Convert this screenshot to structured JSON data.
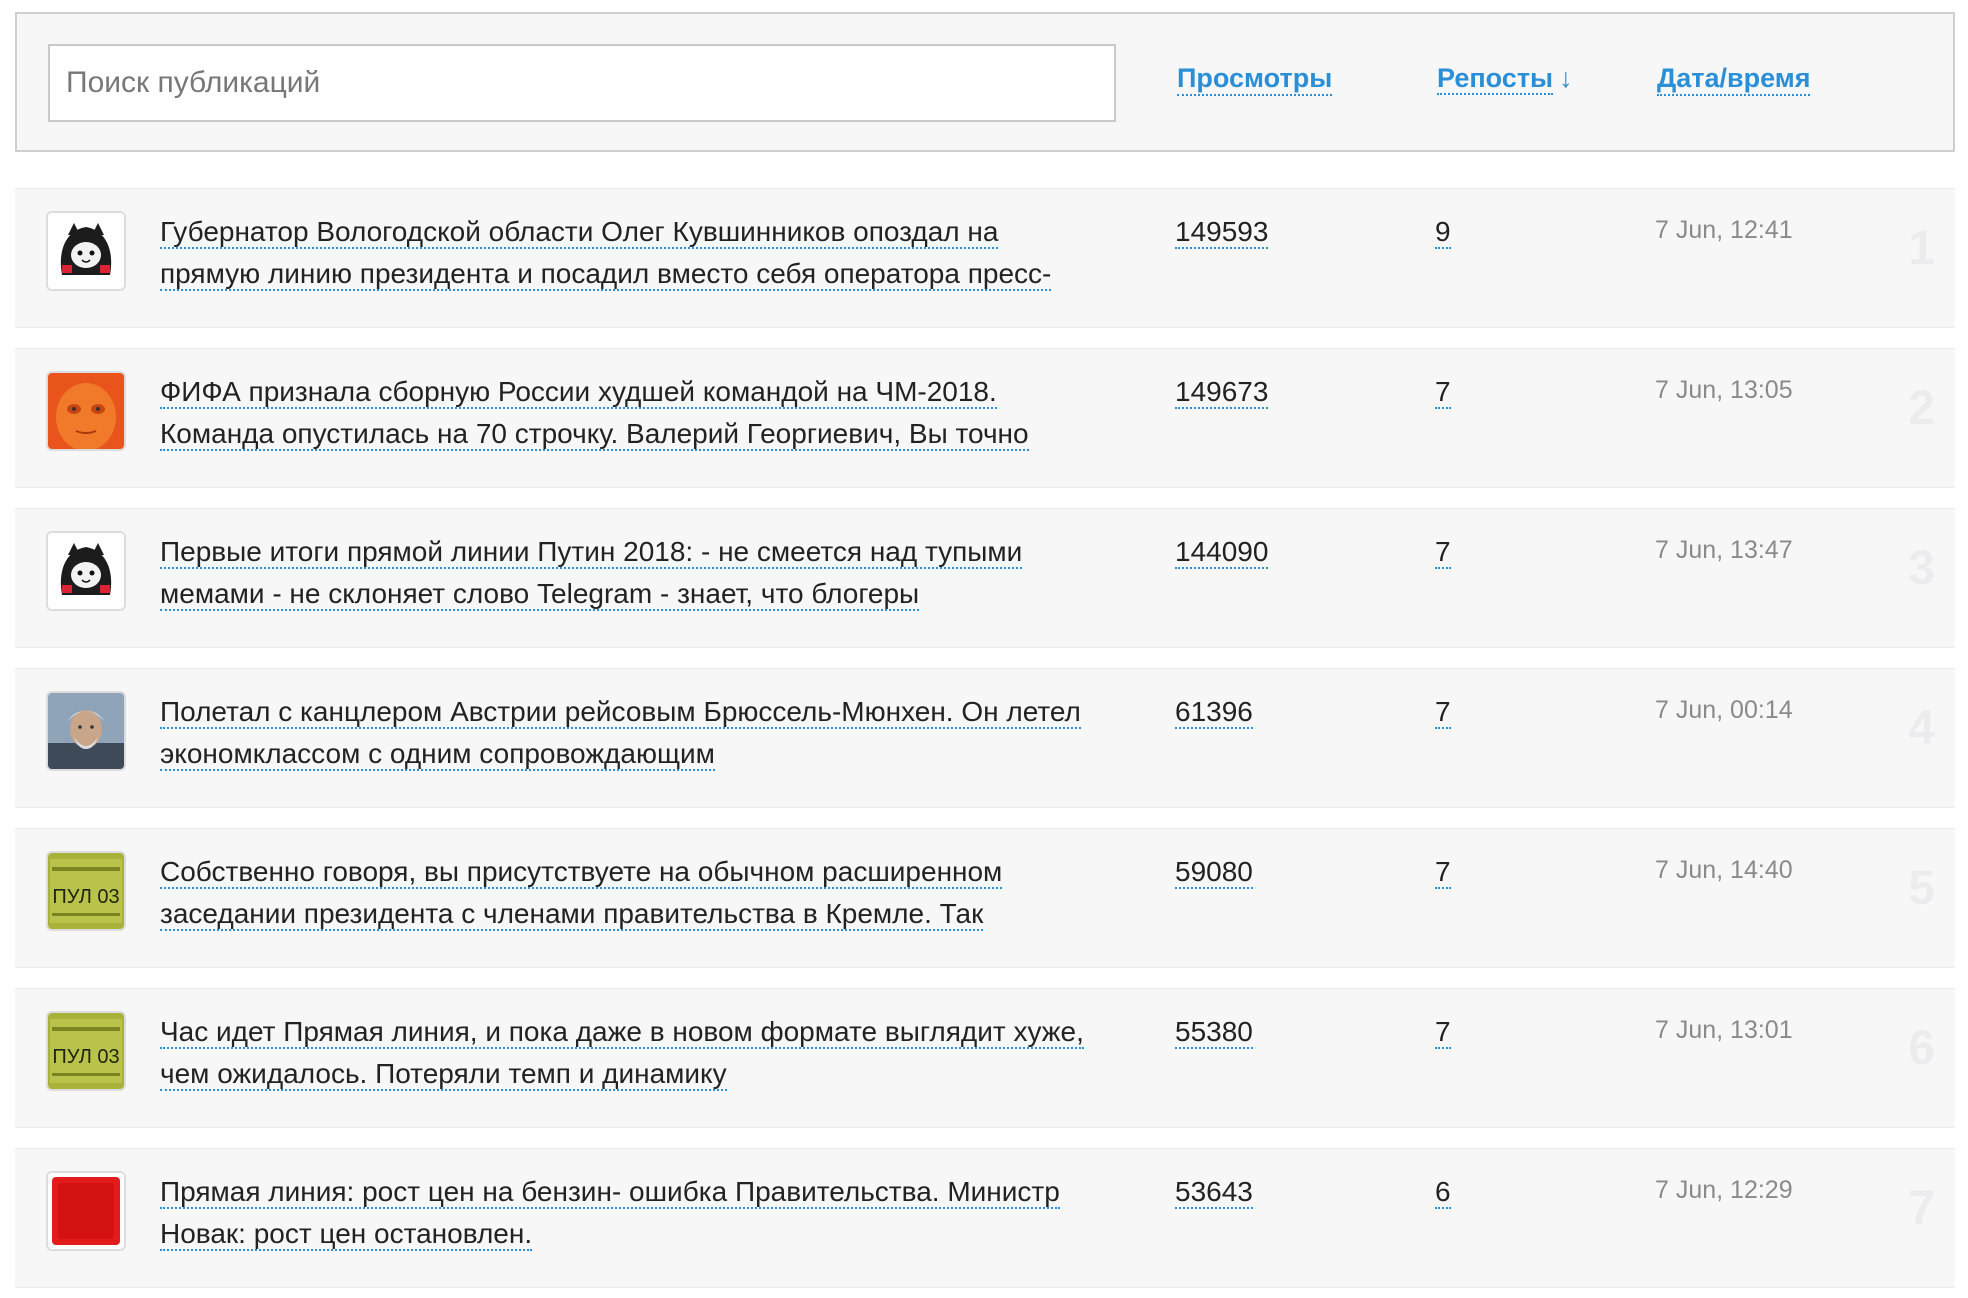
{
  "search": {
    "placeholder": "Поиск публикаций",
    "value": ""
  },
  "columns": {
    "views": "Просмотры",
    "reposts": "Репосты",
    "reposts_arrow": "↓",
    "date": "Дата/время"
  },
  "colors": {
    "accent": "#2a8fd6",
    "row_bg": "#f7f7f8",
    "muted": "#8a8a8a"
  },
  "posts": [
    {
      "rank": "1",
      "avatar": "hooded-cat-avatar",
      "title": "Губернатор Вологодской области Олег Кувшинников опоздал на прямую линию президента и посадил вместо себя оператора пресс-",
      "views": "149593",
      "reposts": "9",
      "date": "7 Jun, 12:41"
    },
    {
      "rank": "2",
      "avatar": "orange-face-avatar",
      "title": "ФИФА признала сборную России худшей командой на ЧМ-2018. Команда опустилась на 70 строчку. Валерий Георгиевич, Вы точно",
      "views": "149673",
      "reposts": "7",
      "date": "7 Jun, 13:05"
    },
    {
      "rank": "3",
      "avatar": "hooded-cat-avatar",
      "title": "Первые итоги прямой линии Путин 2018: - не смеется над тупыми мемами - не склоняет слово Telegram - знает, что блогеры",
      "views": "144090",
      "reposts": "7",
      "date": "7 Jun, 13:47"
    },
    {
      "rank": "4",
      "avatar": "old-man-photo-avatar",
      "title": "Полетал с канцлером Австрии рейсовым Брюссель-Мюнхен. Он летел экономклассом с одним сопровождающим",
      "views": "61396",
      "reposts": "7",
      "date": "7 Jun, 00:14"
    },
    {
      "rank": "5",
      "avatar": "pool-badge-avatar",
      "title": "Собственно говоря, вы присутствуете на обычном расширенном заседании президента с членами правительства в Кремле. Так",
      "views": "59080",
      "reposts": "7",
      "date": "7 Jun, 14:40"
    },
    {
      "rank": "6",
      "avatar": "pool-badge-avatar",
      "title": "Час идет Прямая линия, и пока даже в новом формате выглядит хуже, чем ожидалось. Потеряли темп и динамику",
      "views": "55380",
      "reposts": "7",
      "date": "7 Jun, 13:01"
    },
    {
      "rank": "7",
      "avatar": "red-square-avatar",
      "title": "Прямая линия: рост цен на бензин- ошибка Правительства. Министр Новак: рост цен остановлен.",
      "views": "53643",
      "reposts": "6",
      "date": "7 Jun, 12:29"
    }
  ],
  "badge_text": "ПУЛ 03"
}
